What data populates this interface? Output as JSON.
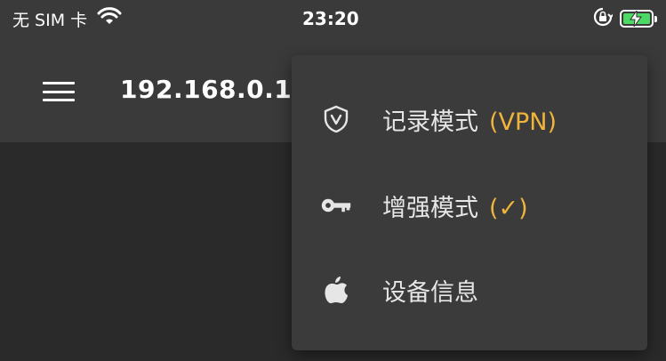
{
  "status_bar": {
    "carrier": "无 SIM 卡",
    "time": "23:20",
    "battery_color": "#4cd964"
  },
  "app_bar": {
    "title": "192.168.0.1"
  },
  "menu": {
    "accent_color": "#f0b43c",
    "items": [
      {
        "label": "记录模式",
        "suffix": "(VPN)",
        "icon": "shield-v-icon"
      },
      {
        "label": "增强模式",
        "suffix": "(✓)",
        "icon": "key-icon"
      },
      {
        "label": "设备信息",
        "suffix": "",
        "icon": "apple-icon"
      }
    ]
  }
}
